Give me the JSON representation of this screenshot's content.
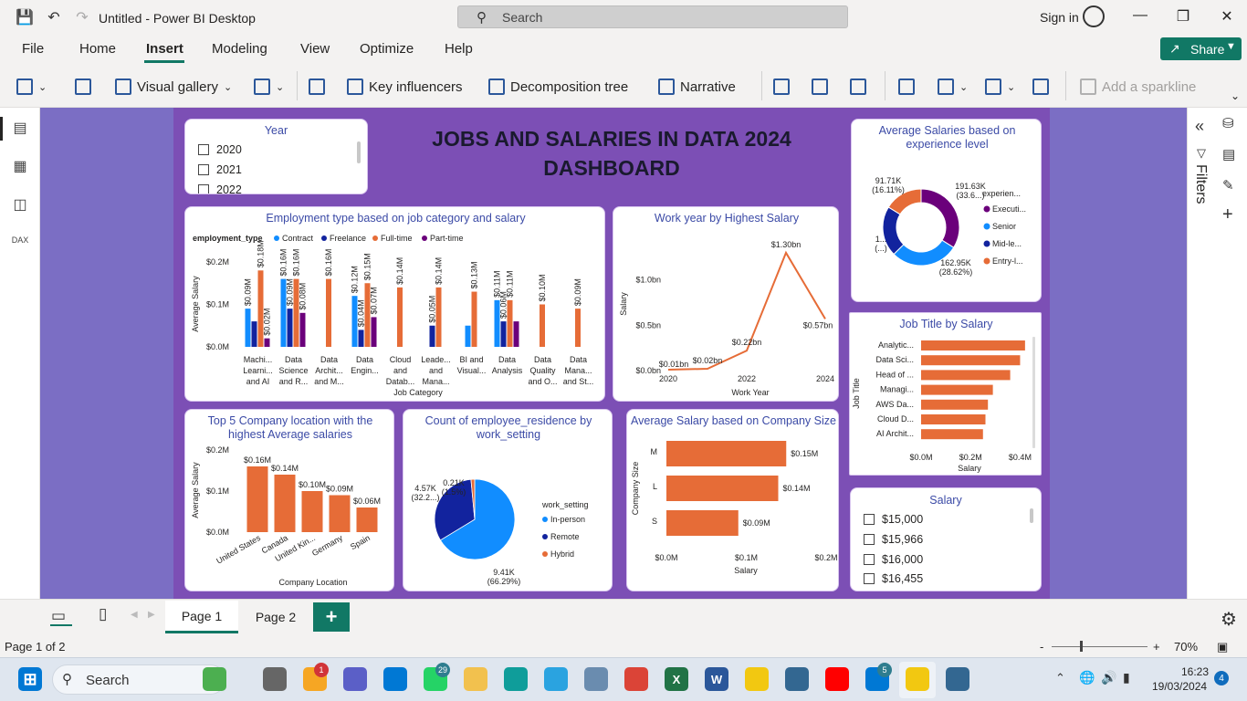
{
  "app": {
    "title": "Untitled - Power BI Desktop",
    "search_placeholder": "Search",
    "sign_in": "Sign in"
  },
  "menu": {
    "items": [
      "File",
      "Home",
      "Insert",
      "Modeling",
      "View",
      "Optimize",
      "Help"
    ],
    "active": "Insert",
    "share": "Share"
  },
  "ribbon": {
    "visual_gallery": "Visual gallery",
    "key_influencers": "Key influencers",
    "decomposition_tree": "Decomposition tree",
    "narrative": "Narrative",
    "add_sparkline": "Add a sparkline"
  },
  "dashboard": {
    "title_line1": "JOBS AND SALARIES IN DATA 2024",
    "title_line2": "DASHBOARD",
    "year_slicer": {
      "title": "Year",
      "items": [
        "2020",
        "2021",
        "2022"
      ]
    },
    "salary_slicer": {
      "title": "Salary",
      "items": [
        "$15,000",
        "$15,966",
        "$16,000",
        "$16,455"
      ]
    }
  },
  "pane": {
    "filters": "Filters"
  },
  "pages": {
    "page1": "Page 1",
    "page2": "Page 2",
    "add": "+"
  },
  "status": {
    "page_info": "Page 1 of 2",
    "zoom": "70%"
  },
  "taskbar": {
    "search": "Search",
    "time": "16:23",
    "date": "19/03/2024",
    "notif_count": "4",
    "badges": {
      "b1": "1",
      "whatsapp": "29",
      "mail": "5"
    }
  },
  "colors": {
    "contract": "#118dff",
    "freelance": "#12239e",
    "fulltime": "#e66c37",
    "parttime": "#6b007b",
    "accent": "#117865",
    "page_bg": "#7c4fb5"
  },
  "chart_data": [
    {
      "id": "employment",
      "type": "bar",
      "title": "Employment type based on job category and salary",
      "legend_title": "employment_type",
      "xlabel": "Job Category",
      "ylabel": "Average Salary",
      "ylim": [
        0,
        0.2
      ],
      "yticks": [
        "$0.0M",
        "$0.1M",
        "$0.2M"
      ],
      "categories": [
        [
          "Machi...",
          "Learni...",
          "and AI"
        ],
        [
          "Data",
          "Science",
          "and R..."
        ],
        [
          "Data",
          "Archit...",
          "and M..."
        ],
        [
          "Data",
          "Engin..."
        ],
        [
          "Cloud",
          "and",
          "Datab..."
        ],
        [
          "Leade...",
          "and",
          "Mana..."
        ],
        [
          "BI and",
          "Visual..."
        ],
        [
          "Data",
          "Analysis"
        ],
        [
          "Data",
          "Quality",
          "and O..."
        ],
        [
          "Data",
          "Mana...",
          "and St..."
        ]
      ],
      "series": [
        {
          "name": "Contract",
          "values": [
            0.09,
            0.16,
            null,
            0.12,
            null,
            null,
            0.05,
            0.11,
            null,
            null
          ],
          "labels": [
            "$0.09M",
            "$0.16M",
            "",
            "$0.12M",
            "",
            "",
            "",
            "$0.11M",
            "",
            ""
          ]
        },
        {
          "name": "Freelance",
          "values": [
            0.06,
            0.09,
            null,
            0.04,
            null,
            0.05,
            null,
            0.06,
            null,
            null
          ],
          "labels": [
            "",
            "$0.09M",
            "",
            "$0.04M",
            "",
            "$0.05M",
            "",
            "$0.06M",
            "",
            ""
          ]
        },
        {
          "name": "Full-time",
          "values": [
            0.18,
            0.16,
            0.16,
            0.15,
            0.14,
            0.14,
            0.13,
            0.11,
            0.1,
            0.09
          ],
          "labels": [
            "$0.18M",
            "$0.16M",
            "$0.16M",
            "$0.15M",
            "$0.14M",
            "$0.14M",
            "$0.13M",
            "$0.11M",
            "$0.10M",
            "$0.09M"
          ]
        },
        {
          "name": "Part-time",
          "values": [
            0.02,
            0.08,
            null,
            0.07,
            null,
            null,
            null,
            0.06,
            null,
            null
          ],
          "labels": [
            "$0.02M",
            "$0.08M",
            "",
            "$0.07M",
            "",
            "",
            "",
            "",
            "",
            ""
          ]
        }
      ]
    },
    {
      "id": "workyear",
      "type": "line",
      "title": "Work year by Highest Salary",
      "xlabel": "Work Year",
      "ylabel": "Salary",
      "x": [
        2020,
        2021,
        2022,
        2023,
        2024
      ],
      "values": [
        0.01,
        0.02,
        0.22,
        1.3,
        0.57
      ],
      "labels": [
        "$0.01bn",
        "$0.02bn",
        "$0.22bn",
        "$1.30bn",
        "$0.57bn"
      ],
      "xticks": [
        "2020",
        "2022",
        "2024"
      ],
      "yticks": [
        "$0.0bn",
        "$0.5bn",
        "$1.0bn"
      ],
      "ylim": [
        0,
        1.4
      ]
    },
    {
      "id": "experience",
      "type": "pie",
      "title": "Average Salaries based on experience level",
      "legend_title": "experien...",
      "categories": [
        "Executi...",
        "Senior",
        "Mid-le...",
        "Entry-l..."
      ],
      "values": [
        191.63,
        162.95,
        120,
        91.71
      ],
      "labels": [
        "191.63K (33.6...)",
        "162.95K (28.62%)",
        "1... (...)",
        "91.71K (16.11%)"
      ],
      "colors": [
        "#6b007b",
        "#118dff",
        "#12239e",
        "#e66c37"
      ]
    },
    {
      "id": "jobtitle",
      "type": "bar",
      "title": "Job Title by Salary",
      "xlabel": "Salary",
      "ylabel": "Job Title",
      "categories": [
        "Analytic...",
        "Data Sci...",
        "Head of ...",
        "Managi...",
        "AWS Da...",
        "Cloud D...",
        "AI Archit..."
      ],
      "values": [
        0.42,
        0.4,
        0.36,
        0.29,
        0.27,
        0.26,
        0.25
      ],
      "xticks": [
        "$0.0M",
        "$0.2M",
        "$0.4M"
      ],
      "xlim": [
        0,
        0.45
      ]
    },
    {
      "id": "location",
      "type": "bar",
      "title": "Top 5 Company location with the highest Average salaries",
      "xlabel": "Company Location",
      "ylabel": "Average Salary",
      "categories": [
        "United States",
        "Canada",
        "United Kin...",
        "Germany",
        "Spain"
      ],
      "values": [
        0.16,
        0.14,
        0.1,
        0.09,
        0.06
      ],
      "labels": [
        "$0.16M",
        "$0.14M",
        "$0.10M",
        "$0.09M",
        "$0.06M"
      ],
      "yticks": [
        "$0.0M",
        "$0.1M",
        "$0.2M"
      ],
      "ylim": [
        0,
        0.2
      ]
    },
    {
      "id": "residence",
      "type": "pie",
      "title": "Count of employee_residence by work_setting",
      "legend_title": "work_setting",
      "categories": [
        "In-person",
        "Remote",
        "Hybrid"
      ],
      "values": [
        9.41,
        4.57,
        0.21
      ],
      "labels": [
        "9.41K (66.29%)",
        "4.57K (32.2...)",
        "0.21K (1.5%)"
      ],
      "colors": [
        "#118dff",
        "#12239e",
        "#e66c37"
      ]
    },
    {
      "id": "companysize",
      "type": "bar",
      "title": "Average Salary based on Company Size",
      "xlabel": "Salary",
      "ylabel": "Company Size",
      "categories": [
        "M",
        "L",
        "S"
      ],
      "values": [
        0.15,
        0.14,
        0.09
      ],
      "labels": [
        "$0.15M",
        "$0.14M",
        "$0.09M"
      ],
      "xticks": [
        "$0.0M",
        "$0.1M",
        "$0.2M"
      ],
      "xlim": [
        0,
        0.2
      ]
    }
  ]
}
